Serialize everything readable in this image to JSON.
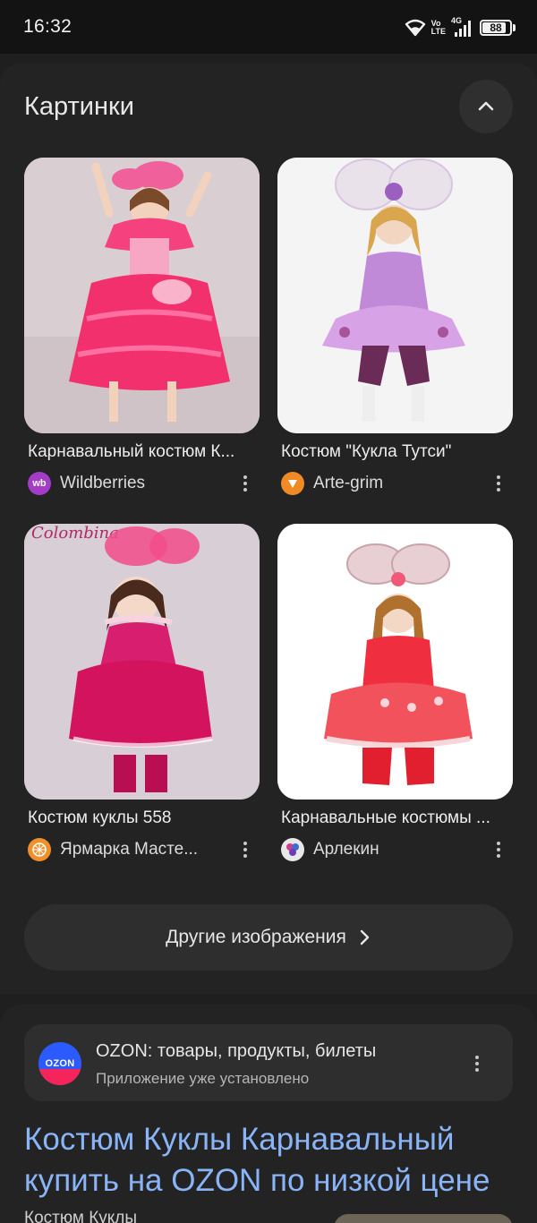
{
  "status_bar": {
    "time": "16:32",
    "volte_top": "Vo",
    "volte_bottom": "LTE",
    "network": "4G",
    "battery": "88",
    "battery_level": 0.88,
    "icons": [
      "wifi-icon",
      "signal-icon",
      "battery-icon"
    ]
  },
  "images_section": {
    "title": "Картинки",
    "collapse_icon": "chevron-up-icon",
    "items": [
      {
        "title": "Карнавальный костюм К...",
        "source": "Wildberries",
        "source_icon_text": "wb",
        "source_color": "#a43cc8",
        "image": "girl in pink tutu dress with bow"
      },
      {
        "title": "Костюм \"Кукла Тутси\"",
        "source": "Arte-grim",
        "source_icon_text": "",
        "source_color": "#f08a24",
        "image": "girl in lilac doll costume"
      },
      {
        "title": "Костюм куклы 558",
        "source": "Ярмарка Масте...",
        "source_icon_text": "",
        "source_color": "#f0902a",
        "image": "girl in crimson doll dress"
      },
      {
        "title": "Карнавальные костюмы ...",
        "source": "Арлекин",
        "source_icon_text": "",
        "source_color": "#e8e8e8",
        "image": "girl in red doll dress"
      }
    ],
    "image_1_overlay_text": "Colombina",
    "more_button": "Другие изображения",
    "more_icon": "chevron-right-icon"
  },
  "result": {
    "app_title": "OZON: товары, продукты, билеты",
    "app_subtitle": "Приложение уже установлено",
    "logo_text": "OZON",
    "title": "Костюм Куклы Карнавальный купить на OZON по низкой цене",
    "snippet": "Костюм Куклы"
  },
  "colors": {
    "background": "#1f1f1f",
    "card": "#232323",
    "link": "#8ab4f8",
    "pill": "#2e2e2e"
  }
}
